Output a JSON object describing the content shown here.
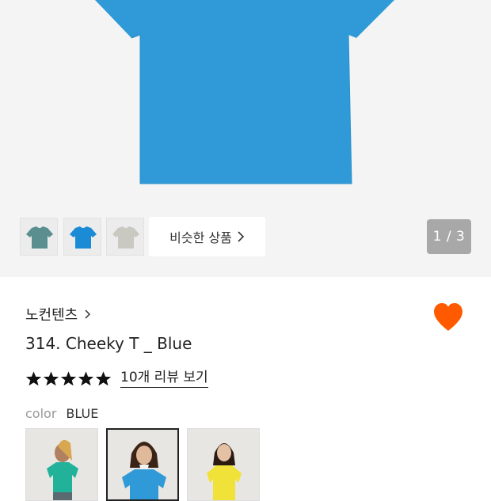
{
  "gallery": {
    "thumbnails": [
      {
        "name": "thumb-teal-tee",
        "color": "#5b8f8f"
      },
      {
        "name": "thumb-blue-tee",
        "color": "#1b8bd6"
      },
      {
        "name": "thumb-grey-tee",
        "color": "#c9c9c2"
      }
    ],
    "similar_button_label": "비슷한 상품",
    "pager_label": "1 / 3",
    "hero_color": "#2f9ad7"
  },
  "product": {
    "brand": "노컨텐츠",
    "title": "314. Cheeky T _ Blue",
    "rating": 5,
    "review_link": "10개 리뷰 보기",
    "color_label": "color",
    "color_value": "BLUE",
    "wishlist_color": "#ff5a00"
  },
  "color_options": [
    {
      "name": "green",
      "shirt_color": "#22b29a",
      "selected": false
    },
    {
      "name": "blue",
      "shirt_color": "#2f9ad7",
      "selected": true
    },
    {
      "name": "yellow",
      "shirt_color": "#f1e23a",
      "selected": false
    }
  ]
}
